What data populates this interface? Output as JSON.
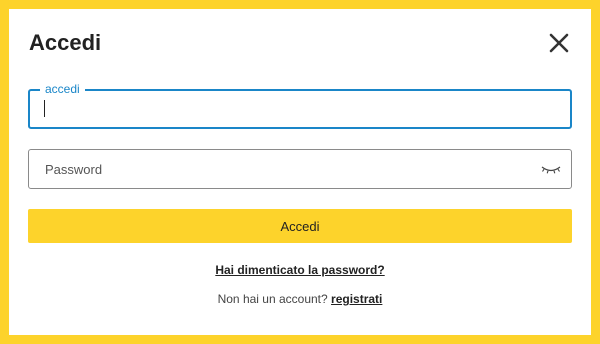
{
  "modal": {
    "title": "Accedi",
    "close_icon": "close-icon"
  },
  "form": {
    "username": {
      "label": "accedi",
      "value": ""
    },
    "password": {
      "placeholder": "Password",
      "value": "",
      "toggle_icon": "eye-closed-icon"
    },
    "submit_label": "Accedi",
    "forgot_password_label": "Hai dimenticato la password?",
    "register_prompt": "Non hai un account?",
    "register_label": "registrati"
  },
  "colors": {
    "accent": "#fdd32b",
    "focus": "#1a86c8",
    "text": "#222222"
  }
}
